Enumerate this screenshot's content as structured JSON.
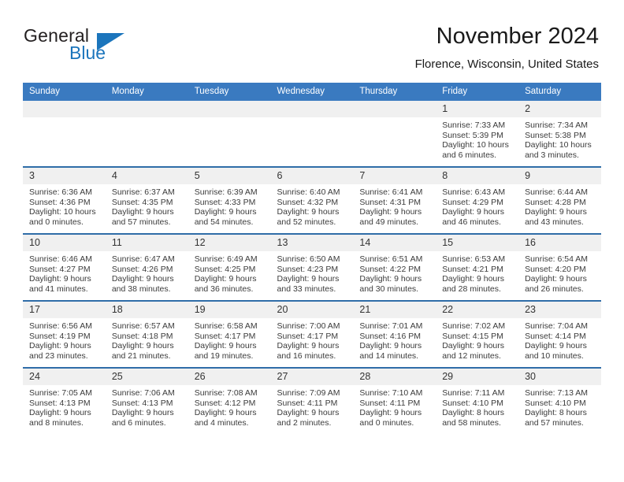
{
  "brand": {
    "name_top": "General",
    "name_bottom": "Blue",
    "accent_color": "#1b75bc",
    "triangle_icon": "brand-triangle-icon"
  },
  "header": {
    "title": "November 2024",
    "subtitle": "Florence, Wisconsin, United States"
  },
  "theme": {
    "header_blue": "#3a7ac0",
    "row_border_blue": "#2f6da8",
    "daynum_band": "#f0f0f0"
  },
  "weekdays": [
    "Sunday",
    "Monday",
    "Tuesday",
    "Wednesday",
    "Thursday",
    "Friday",
    "Saturday"
  ],
  "weeks": [
    [
      {
        "day": "",
        "blank": true,
        "sunrise": "",
        "sunset": "",
        "daylight_1": "",
        "daylight_2": ""
      },
      {
        "day": "",
        "blank": true,
        "sunrise": "",
        "sunset": "",
        "daylight_1": "",
        "daylight_2": ""
      },
      {
        "day": "",
        "blank": true,
        "sunrise": "",
        "sunset": "",
        "daylight_1": "",
        "daylight_2": ""
      },
      {
        "day": "",
        "blank": true,
        "sunrise": "",
        "sunset": "",
        "daylight_1": "",
        "daylight_2": ""
      },
      {
        "day": "",
        "blank": true,
        "sunrise": "",
        "sunset": "",
        "daylight_1": "",
        "daylight_2": ""
      },
      {
        "day": "1",
        "sunrise": "Sunrise: 7:33 AM",
        "sunset": "Sunset: 5:39 PM",
        "daylight_1": "Daylight: 10 hours",
        "daylight_2": "and 6 minutes."
      },
      {
        "day": "2",
        "sunrise": "Sunrise: 7:34 AM",
        "sunset": "Sunset: 5:38 PM",
        "daylight_1": "Daylight: 10 hours",
        "daylight_2": "and 3 minutes."
      }
    ],
    [
      {
        "day": "3",
        "sunrise": "Sunrise: 6:36 AM",
        "sunset": "Sunset: 4:36 PM",
        "daylight_1": "Daylight: 10 hours",
        "daylight_2": "and 0 minutes."
      },
      {
        "day": "4",
        "sunrise": "Sunrise: 6:37 AM",
        "sunset": "Sunset: 4:35 PM",
        "daylight_1": "Daylight: 9 hours",
        "daylight_2": "and 57 minutes."
      },
      {
        "day": "5",
        "sunrise": "Sunrise: 6:39 AM",
        "sunset": "Sunset: 4:33 PM",
        "daylight_1": "Daylight: 9 hours",
        "daylight_2": "and 54 minutes."
      },
      {
        "day": "6",
        "sunrise": "Sunrise: 6:40 AM",
        "sunset": "Sunset: 4:32 PM",
        "daylight_1": "Daylight: 9 hours",
        "daylight_2": "and 52 minutes."
      },
      {
        "day": "7",
        "sunrise": "Sunrise: 6:41 AM",
        "sunset": "Sunset: 4:31 PM",
        "daylight_1": "Daylight: 9 hours",
        "daylight_2": "and 49 minutes."
      },
      {
        "day": "8",
        "sunrise": "Sunrise: 6:43 AM",
        "sunset": "Sunset: 4:29 PM",
        "daylight_1": "Daylight: 9 hours",
        "daylight_2": "and 46 minutes."
      },
      {
        "day": "9",
        "sunrise": "Sunrise: 6:44 AM",
        "sunset": "Sunset: 4:28 PM",
        "daylight_1": "Daylight: 9 hours",
        "daylight_2": "and 43 minutes."
      }
    ],
    [
      {
        "day": "10",
        "sunrise": "Sunrise: 6:46 AM",
        "sunset": "Sunset: 4:27 PM",
        "daylight_1": "Daylight: 9 hours",
        "daylight_2": "and 41 minutes."
      },
      {
        "day": "11",
        "sunrise": "Sunrise: 6:47 AM",
        "sunset": "Sunset: 4:26 PM",
        "daylight_1": "Daylight: 9 hours",
        "daylight_2": "and 38 minutes."
      },
      {
        "day": "12",
        "sunrise": "Sunrise: 6:49 AM",
        "sunset": "Sunset: 4:25 PM",
        "daylight_1": "Daylight: 9 hours",
        "daylight_2": "and 36 minutes."
      },
      {
        "day": "13",
        "sunrise": "Sunrise: 6:50 AM",
        "sunset": "Sunset: 4:23 PM",
        "daylight_1": "Daylight: 9 hours",
        "daylight_2": "and 33 minutes."
      },
      {
        "day": "14",
        "sunrise": "Sunrise: 6:51 AM",
        "sunset": "Sunset: 4:22 PM",
        "daylight_1": "Daylight: 9 hours",
        "daylight_2": "and 30 minutes."
      },
      {
        "day": "15",
        "sunrise": "Sunrise: 6:53 AM",
        "sunset": "Sunset: 4:21 PM",
        "daylight_1": "Daylight: 9 hours",
        "daylight_2": "and 28 minutes."
      },
      {
        "day": "16",
        "sunrise": "Sunrise: 6:54 AM",
        "sunset": "Sunset: 4:20 PM",
        "daylight_1": "Daylight: 9 hours",
        "daylight_2": "and 26 minutes."
      }
    ],
    [
      {
        "day": "17",
        "sunrise": "Sunrise: 6:56 AM",
        "sunset": "Sunset: 4:19 PM",
        "daylight_1": "Daylight: 9 hours",
        "daylight_2": "and 23 minutes."
      },
      {
        "day": "18",
        "sunrise": "Sunrise: 6:57 AM",
        "sunset": "Sunset: 4:18 PM",
        "daylight_1": "Daylight: 9 hours",
        "daylight_2": "and 21 minutes."
      },
      {
        "day": "19",
        "sunrise": "Sunrise: 6:58 AM",
        "sunset": "Sunset: 4:17 PM",
        "daylight_1": "Daylight: 9 hours",
        "daylight_2": "and 19 minutes."
      },
      {
        "day": "20",
        "sunrise": "Sunrise: 7:00 AM",
        "sunset": "Sunset: 4:17 PM",
        "daylight_1": "Daylight: 9 hours",
        "daylight_2": "and 16 minutes."
      },
      {
        "day": "21",
        "sunrise": "Sunrise: 7:01 AM",
        "sunset": "Sunset: 4:16 PM",
        "daylight_1": "Daylight: 9 hours",
        "daylight_2": "and 14 minutes."
      },
      {
        "day": "22",
        "sunrise": "Sunrise: 7:02 AM",
        "sunset": "Sunset: 4:15 PM",
        "daylight_1": "Daylight: 9 hours",
        "daylight_2": "and 12 minutes."
      },
      {
        "day": "23",
        "sunrise": "Sunrise: 7:04 AM",
        "sunset": "Sunset: 4:14 PM",
        "daylight_1": "Daylight: 9 hours",
        "daylight_2": "and 10 minutes."
      }
    ],
    [
      {
        "day": "24",
        "sunrise": "Sunrise: 7:05 AM",
        "sunset": "Sunset: 4:13 PM",
        "daylight_1": "Daylight: 9 hours",
        "daylight_2": "and 8 minutes."
      },
      {
        "day": "25",
        "sunrise": "Sunrise: 7:06 AM",
        "sunset": "Sunset: 4:13 PM",
        "daylight_1": "Daylight: 9 hours",
        "daylight_2": "and 6 minutes."
      },
      {
        "day": "26",
        "sunrise": "Sunrise: 7:08 AM",
        "sunset": "Sunset: 4:12 PM",
        "daylight_1": "Daylight: 9 hours",
        "daylight_2": "and 4 minutes."
      },
      {
        "day": "27",
        "sunrise": "Sunrise: 7:09 AM",
        "sunset": "Sunset: 4:11 PM",
        "daylight_1": "Daylight: 9 hours",
        "daylight_2": "and 2 minutes."
      },
      {
        "day": "28",
        "sunrise": "Sunrise: 7:10 AM",
        "sunset": "Sunset: 4:11 PM",
        "daylight_1": "Daylight: 9 hours",
        "daylight_2": "and 0 minutes."
      },
      {
        "day": "29",
        "sunrise": "Sunrise: 7:11 AM",
        "sunset": "Sunset: 4:10 PM",
        "daylight_1": "Daylight: 8 hours",
        "daylight_2": "and 58 minutes."
      },
      {
        "day": "30",
        "sunrise": "Sunrise: 7:13 AM",
        "sunset": "Sunset: 4:10 PM",
        "daylight_1": "Daylight: 8 hours",
        "daylight_2": "and 57 minutes."
      }
    ]
  ]
}
